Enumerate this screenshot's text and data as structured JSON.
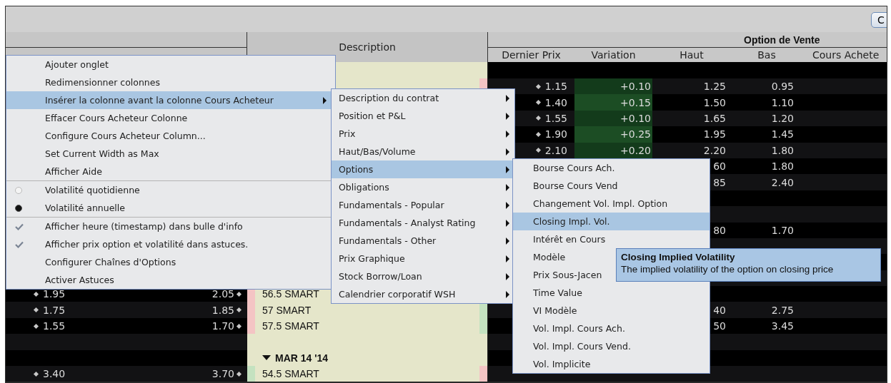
{
  "toolbar": {
    "button": "C"
  },
  "header": {
    "description": "Description",
    "group": "Option de Vente",
    "columns": [
      "Dernier Prix",
      "Variation",
      "Haut",
      "Bas",
      "Cours Achete"
    ]
  },
  "rows": [
    {
      "kind": "data"
    },
    {
      "kind": "data",
      "last": "1.15",
      "change": "+0.10",
      "high": "1.25",
      "low": "0.95",
      "right_mark": {
        "color": "#f4c4c4"
      }
    },
    {
      "kind": "data",
      "last": "1.40",
      "change": "+0.15",
      "high": "1.50",
      "low": "1.10"
    },
    {
      "kind": "data",
      "last": "1.55",
      "change": "+0.10",
      "high": "1.65",
      "low": "1.20"
    },
    {
      "kind": "data",
      "last": "1.90",
      "change": "+0.25",
      "high": "1.95",
      "low": "1.45"
    },
    {
      "kind": "data",
      "last": "2.10",
      "change": "+0.20",
      "high": "2.20",
      "low": "1.80"
    },
    {
      "kind": "data",
      "high": "60",
      "low": "1.80"
    },
    {
      "kind": "data",
      "high": "85",
      "low": "2.40"
    },
    {
      "kind": "data"
    },
    {
      "kind": "data"
    },
    {
      "kind": "data",
      "high": "80",
      "low": "1.70"
    },
    {
      "kind": "data"
    },
    {
      "kind": "data"
    },
    {
      "kind": "data"
    },
    {
      "kind": "data",
      "bid": "1.95",
      "ask": "2.05",
      "description": "56.5 SMART",
      "left_mark": {
        "color": "#f4c4c4"
      }
    },
    {
      "kind": "data",
      "bid": "1.75",
      "ask": "1.85",
      "description": "57 SMART",
      "high": "40",
      "low": "2.75",
      "left_mark": {
        "color": "#f4c4c4"
      },
      "right_mark": {
        "color": "#c4e2c0"
      }
    },
    {
      "kind": "data",
      "bid": "1.55",
      "ask": "1.70",
      "description": "57.5 SMART",
      "high": "50",
      "low": "3.45",
      "left_mark": {
        "color": "#f4c4c4"
      },
      "right_mark": {
        "color": "#c4e2c0"
      }
    },
    {
      "kind": "data"
    },
    {
      "kind": "group",
      "label": "MAR 14 '14",
      "expanded": true
    },
    {
      "kind": "data",
      "bid": "3.40",
      "ask": "3.70",
      "description": "54.5 SMART",
      "left_mark": {
        "color": "#c4e2c0"
      },
      "right_mark": {
        "color": "#f4c4c4"
      }
    }
  ],
  "context_menu": {
    "groups": [
      [
        {
          "label": "Ajouter onglet",
          "kind": "command",
          "highlighted": false
        },
        {
          "label": "Redimensionner colonnes",
          "kind": "command",
          "highlighted": false
        },
        {
          "label": "Insérer la colonne avant la colonne Cours Acheteur",
          "kind": "command",
          "highlighted": true,
          "submenu": true
        },
        {
          "label": "Effacer Cours Acheteur Colonne",
          "kind": "command",
          "highlighted": false
        },
        {
          "label": "Configure Cours Acheteur Column...",
          "kind": "command",
          "highlighted": false
        },
        {
          "label": "Set Current Width as Max",
          "kind": "command",
          "highlighted": false
        },
        {
          "label": "Afficher Aide",
          "kind": "command",
          "highlighted": false
        }
      ],
      [
        {
          "label": "Volatilité quotidienne",
          "kind": "radio",
          "checked": false,
          "highlighted": false
        },
        {
          "label": "Volatilité annuelle",
          "kind": "radio",
          "checked": true,
          "highlighted": false
        }
      ],
      [
        {
          "label": "Afficher heure (timestamp) dans bulle d'info",
          "kind": "check",
          "checked": true,
          "highlighted": false
        },
        {
          "label": "Afficher prix option et volatilité dans astuces.",
          "kind": "check",
          "checked": true,
          "highlighted": false
        },
        {
          "label": "Configurer Chaînes d'Options",
          "kind": "command",
          "highlighted": false
        },
        {
          "label": "Activer Astuces",
          "kind": "command",
          "highlighted": false
        }
      ]
    ]
  },
  "submenu": {
    "items": [
      {
        "label": "Description du contrat",
        "highlighted": false,
        "submenu": true
      },
      {
        "label": "Position et P&L",
        "highlighted": false,
        "submenu": true
      },
      {
        "label": "Prix",
        "highlighted": false,
        "submenu": true
      },
      {
        "label": "Haut/Bas/Volume",
        "highlighted": false,
        "submenu": true
      },
      {
        "label": "Options",
        "highlighted": true,
        "submenu": true
      },
      {
        "label": "Obligations",
        "highlighted": false,
        "submenu": true
      },
      {
        "label": "Fundamentals - Popular",
        "highlighted": false,
        "submenu": true
      },
      {
        "label": "Fundamentals - Analyst Rating",
        "highlighted": false,
        "submenu": true
      },
      {
        "label": "Fundamentals - Other",
        "highlighted": false,
        "submenu": true
      },
      {
        "label": "Prix Graphique",
        "highlighted": false,
        "submenu": true
      },
      {
        "label": "Stock Borrow/Loan",
        "highlighted": false,
        "submenu": true
      },
      {
        "label": "Calendrier corporatif WSH",
        "highlighted": false,
        "submenu": true
      }
    ]
  },
  "options_submenu": {
    "items": [
      {
        "label": "Bourse Cours Ach.",
        "highlighted": false
      },
      {
        "label": "Bourse Cours Vend",
        "highlighted": false
      },
      {
        "label": "Changement Vol. Impl. Option",
        "highlighted": false
      },
      {
        "label": "Closing Impl. Vol.",
        "highlighted": true
      },
      {
        "label": "Intérêt en Cours",
        "highlighted": false
      },
      {
        "label": "Modèle",
        "highlighted": false
      },
      {
        "label": "Prix Sous-Jacen",
        "highlighted": false
      },
      {
        "label": "Time Value",
        "highlighted": false
      },
      {
        "label": "VI Modèle",
        "highlighted": false
      },
      {
        "label": "Vol. Impl. Cours Ach.",
        "highlighted": false
      },
      {
        "label": "Vol. Impl. Cours Vend.",
        "highlighted": false
      },
      {
        "label": "Vol. Implicite",
        "highlighted": false
      }
    ]
  },
  "tooltip": {
    "title": "Closing Implied Volatility",
    "text": "The implied volatility of the option on closing price"
  }
}
